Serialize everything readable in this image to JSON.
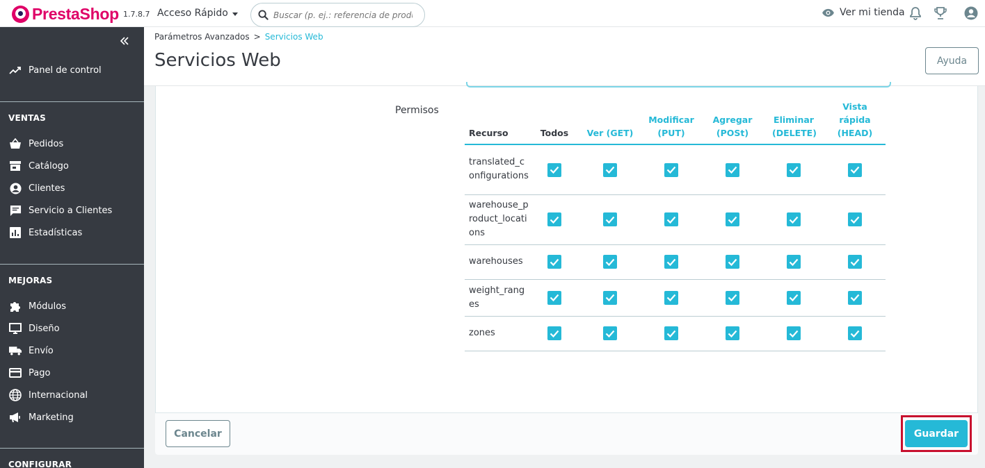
{
  "header": {
    "brand": "PrestaShop",
    "version": "1.7.8.7",
    "quick_access": "Acceso Rápido",
    "search_placeholder": "Buscar (p. ej.: referencia de producto,",
    "view_shop": "Ver mi tienda"
  },
  "sidebar": {
    "dashboard": "Panel de control",
    "sections": [
      {
        "title": "VENTAS",
        "items": [
          "Pedidos",
          "Catálogo",
          "Clientes",
          "Servicio a Clientes",
          "Estadísticas"
        ]
      },
      {
        "title": "MEJORAS",
        "items": [
          "Módulos",
          "Diseño",
          "Envío",
          "Pago",
          "Internacional",
          "Marketing"
        ]
      },
      {
        "title": "CONFIGURAR",
        "items": []
      }
    ]
  },
  "breadcrumb": {
    "parent": "Parámetros Avanzados",
    "separator": ">",
    "current": "Servicios Web"
  },
  "page": {
    "title": "Servicios Web",
    "help_label": "Ayuda"
  },
  "permissions": {
    "label": "Permisos",
    "columns": {
      "resource": "Recurso",
      "all": "Todos",
      "get": "Ver (GET)",
      "put": "Modificar (PUT)",
      "post": "Agregar (POSt)",
      "delete": "Eliminar (DELETE)",
      "head": "Vista rápida (HEAD)"
    },
    "rows": [
      "translated_configurations",
      "warehouse_product_locations",
      "warehouses",
      "weight_ranges",
      "zones"
    ],
    "all_checked": true
  },
  "footer": {
    "cancel_label": "Cancelar",
    "save_label": "Guardar"
  },
  "colors": {
    "accent": "#25b9d7",
    "brand": "#df0067",
    "sidebar": "#363a41",
    "highlight": "#c8102e"
  }
}
